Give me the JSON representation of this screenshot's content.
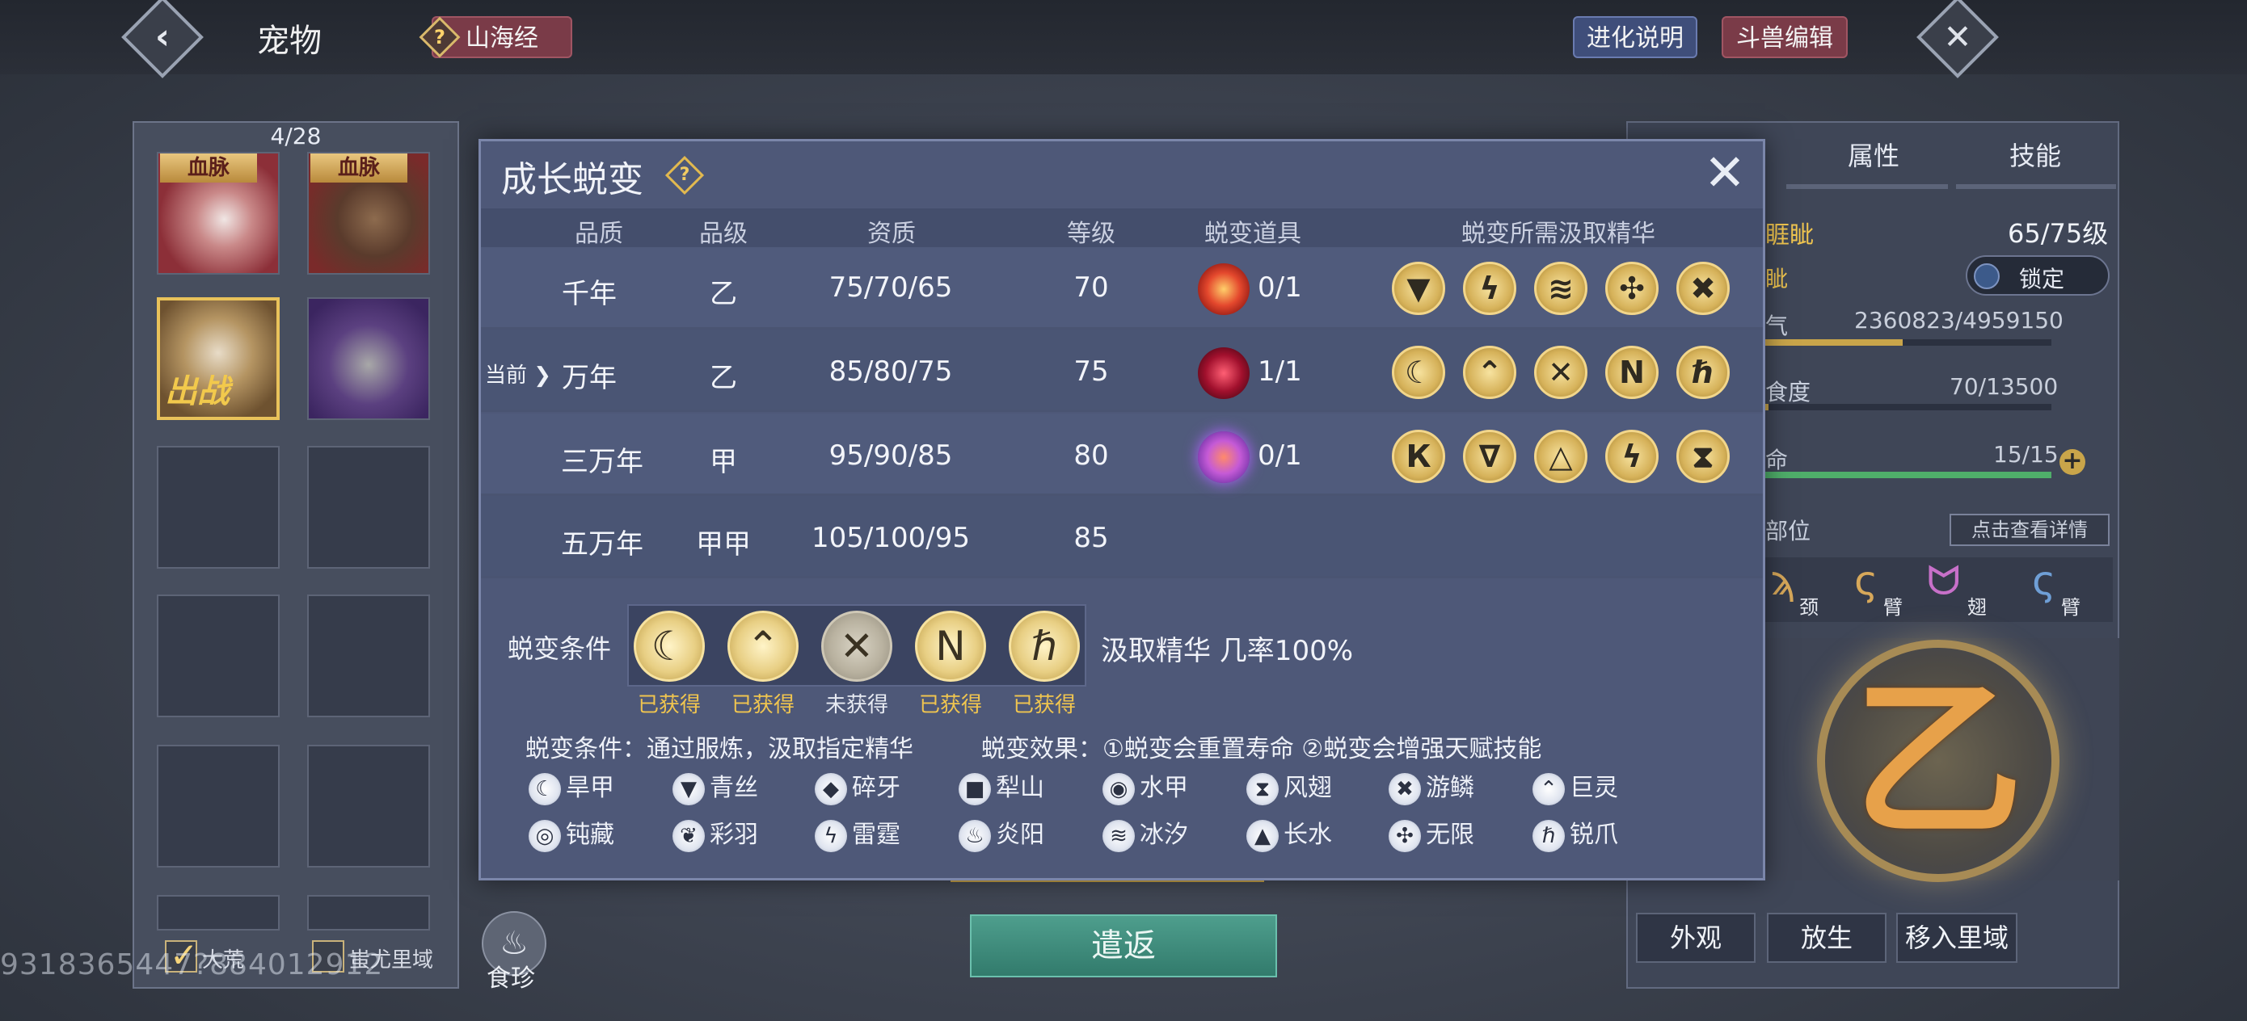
{
  "header": {
    "back_icon": "chevron-left-icon",
    "title": "宠物",
    "shanhaijing_label": "山海经",
    "evolution_help_label": "进化说明",
    "beast_edit_label": "斗兽编辑",
    "close_icon": "close-icon"
  },
  "left_panel": {
    "count": "4/28",
    "bloodline_label": "血脉",
    "battle_label": "出战",
    "filters": [
      {
        "label": "大荒",
        "checked": true
      },
      {
        "label": "蚩尤里域",
        "checked": false
      }
    ],
    "watermark": "9318365447?884012912"
  },
  "right_panel": {
    "tabs": [
      "属性",
      "技能"
    ],
    "rows": [
      {
        "label": "睚眦",
        "value": "65/75级"
      },
      {
        "label": "眦",
        "value": ""
      },
      {
        "label": "气",
        "value": "2360823/4959150"
      },
      {
        "label": "食度",
        "value": "70/13500"
      },
      {
        "label": "命",
        "value": "15/15"
      }
    ],
    "progress": {
      "qi": 0.48,
      "food": 0.005,
      "life": 1.0
    },
    "lock_label": "锁定",
    "parts_label": "部位",
    "detail_label": "点击查看详情",
    "parts": [
      "颈",
      "臂",
      "翅",
      "臂"
    ],
    "emblem_glyph": "乙",
    "buttons": [
      "外观",
      "放生",
      "移入里域"
    ]
  },
  "bottom": {
    "return_label": "遣返",
    "food_label": "食珍"
  },
  "modal": {
    "title": "成长蜕变",
    "headers": [
      "品质",
      "品级",
      "资质",
      "等级",
      "蜕变道具",
      "蜕变所需汲取精华"
    ],
    "current_label": "当前",
    "rows": [
      {
        "quality": "千年",
        "grade": "乙",
        "aptitude": "75/70/65",
        "level": "70",
        "item_count": "0/1",
        "essences": [
          "▼",
          "ϟ",
          "≋",
          "✣",
          "✖"
        ]
      },
      {
        "quality": "万年",
        "grade": "乙",
        "aptitude": "85/80/75",
        "level": "75",
        "item_count": "1/1",
        "essences": [
          "☾",
          "⌃",
          "✕",
          "N",
          "ℏ"
        ]
      },
      {
        "quality": "三万年",
        "grade": "甲",
        "aptitude": "95/90/85",
        "level": "80",
        "item_count": "0/1",
        "essences": [
          "К",
          "∇",
          "△",
          "ϟ",
          "⧗"
        ]
      },
      {
        "quality": "五万年",
        "grade": "甲甲",
        "aptitude": "105/100/95",
        "level": "85",
        "item_count": "",
        "essences": []
      }
    ],
    "condition_label": "蜕变条件",
    "condition_icons": [
      "☾",
      "⌃",
      "✕",
      "N",
      "ℏ"
    ],
    "condition_status": [
      "已获得",
      "已获得",
      "未获得",
      "已获得",
      "已获得"
    ],
    "rate_text": "汲取精华 几率100%",
    "desc_condition": "蜕变条件：通过服炼，汲取指定精华",
    "desc_effect": "蜕变效果：①蜕变会重置寿命 ②蜕变会增强天赋技能",
    "legend": [
      {
        "icon": "☾",
        "name": "旱甲"
      },
      {
        "icon": "▼",
        "name": "青丝"
      },
      {
        "icon": "◆",
        "name": "碎牙"
      },
      {
        "icon": "■",
        "name": "犁山"
      },
      {
        "icon": "◉",
        "name": "水甲"
      },
      {
        "icon": "⧗",
        "name": "风翅"
      },
      {
        "icon": "✖",
        "name": "游鳞"
      },
      {
        "icon": "⌃",
        "name": "巨灵"
      },
      {
        "icon": "◎",
        "name": "钝藏"
      },
      {
        "icon": "❦",
        "name": "彩羽"
      },
      {
        "icon": "ϟ",
        "name": "雷霆"
      },
      {
        "icon": "♨",
        "name": "炎阳"
      },
      {
        "icon": "≋",
        "name": "冰汐"
      },
      {
        "icon": "▲",
        "name": "长水"
      },
      {
        "icon": "✣",
        "name": "无限"
      },
      {
        "icon": "ℏ",
        "name": "锐爪"
      }
    ]
  },
  "colors": {
    "modal_bg": "#4e5878",
    "gold_status": "#f0c54f",
    "return_button": "#3f8c7c"
  }
}
